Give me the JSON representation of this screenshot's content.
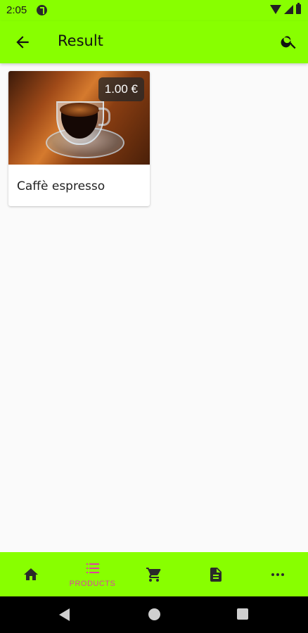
{
  "status_bar": {
    "time": "2:05"
  },
  "app_bar": {
    "title": "Result"
  },
  "products": [
    {
      "name": "Caffè espresso",
      "price": "1.00 €"
    }
  ],
  "bottom_nav": {
    "items": [
      {
        "icon": "home-icon",
        "label": ""
      },
      {
        "icon": "list-icon",
        "label": "PRODUCTS",
        "active": true
      },
      {
        "icon": "cart-icon",
        "label": ""
      },
      {
        "icon": "document-icon",
        "label": ""
      },
      {
        "icon": "more-icon",
        "label": ""
      }
    ]
  },
  "colors": {
    "accent": "#88ff00",
    "active_tab": "#e040a0"
  }
}
